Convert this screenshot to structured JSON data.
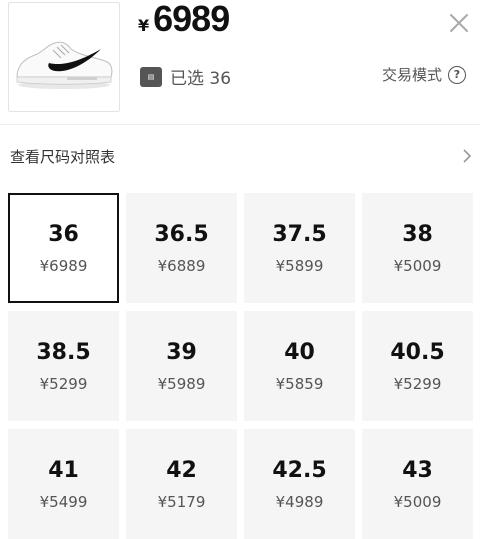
{
  "header": {
    "currency_symbol": "¥",
    "price": "6989",
    "selected_text": "已选 36",
    "trade_mode_label": "交易模式"
  },
  "size_chart_link": {
    "label": "查看尺码对照表"
  },
  "sizes": [
    {
      "size": "36",
      "price": "¥6989",
      "selected": true
    },
    {
      "size": "36.5",
      "price": "¥6889"
    },
    {
      "size": "37.5",
      "price": "¥5899"
    },
    {
      "size": "38",
      "price": "¥5009"
    },
    {
      "size": "38.5",
      "price": "¥5299"
    },
    {
      "size": "39",
      "price": "¥5989"
    },
    {
      "size": "40",
      "price": "¥5859"
    },
    {
      "size": "40.5",
      "price": "¥5299"
    },
    {
      "size": "41",
      "price": "¥5499"
    },
    {
      "size": "42",
      "price": "¥5179"
    },
    {
      "size": "42.5",
      "price": "¥4989"
    },
    {
      "size": "43",
      "price": "¥5009"
    }
  ],
  "colors": {
    "selected_border": "#111111",
    "cell_background": "#f5f5f5",
    "secondary_text": "#555555"
  },
  "icons": {
    "product": "sneaker-thumbnail",
    "close": "close-icon",
    "badge": "tag-badge-icon",
    "help": "question-circle-icon",
    "chevron": "chevron-right-icon"
  }
}
